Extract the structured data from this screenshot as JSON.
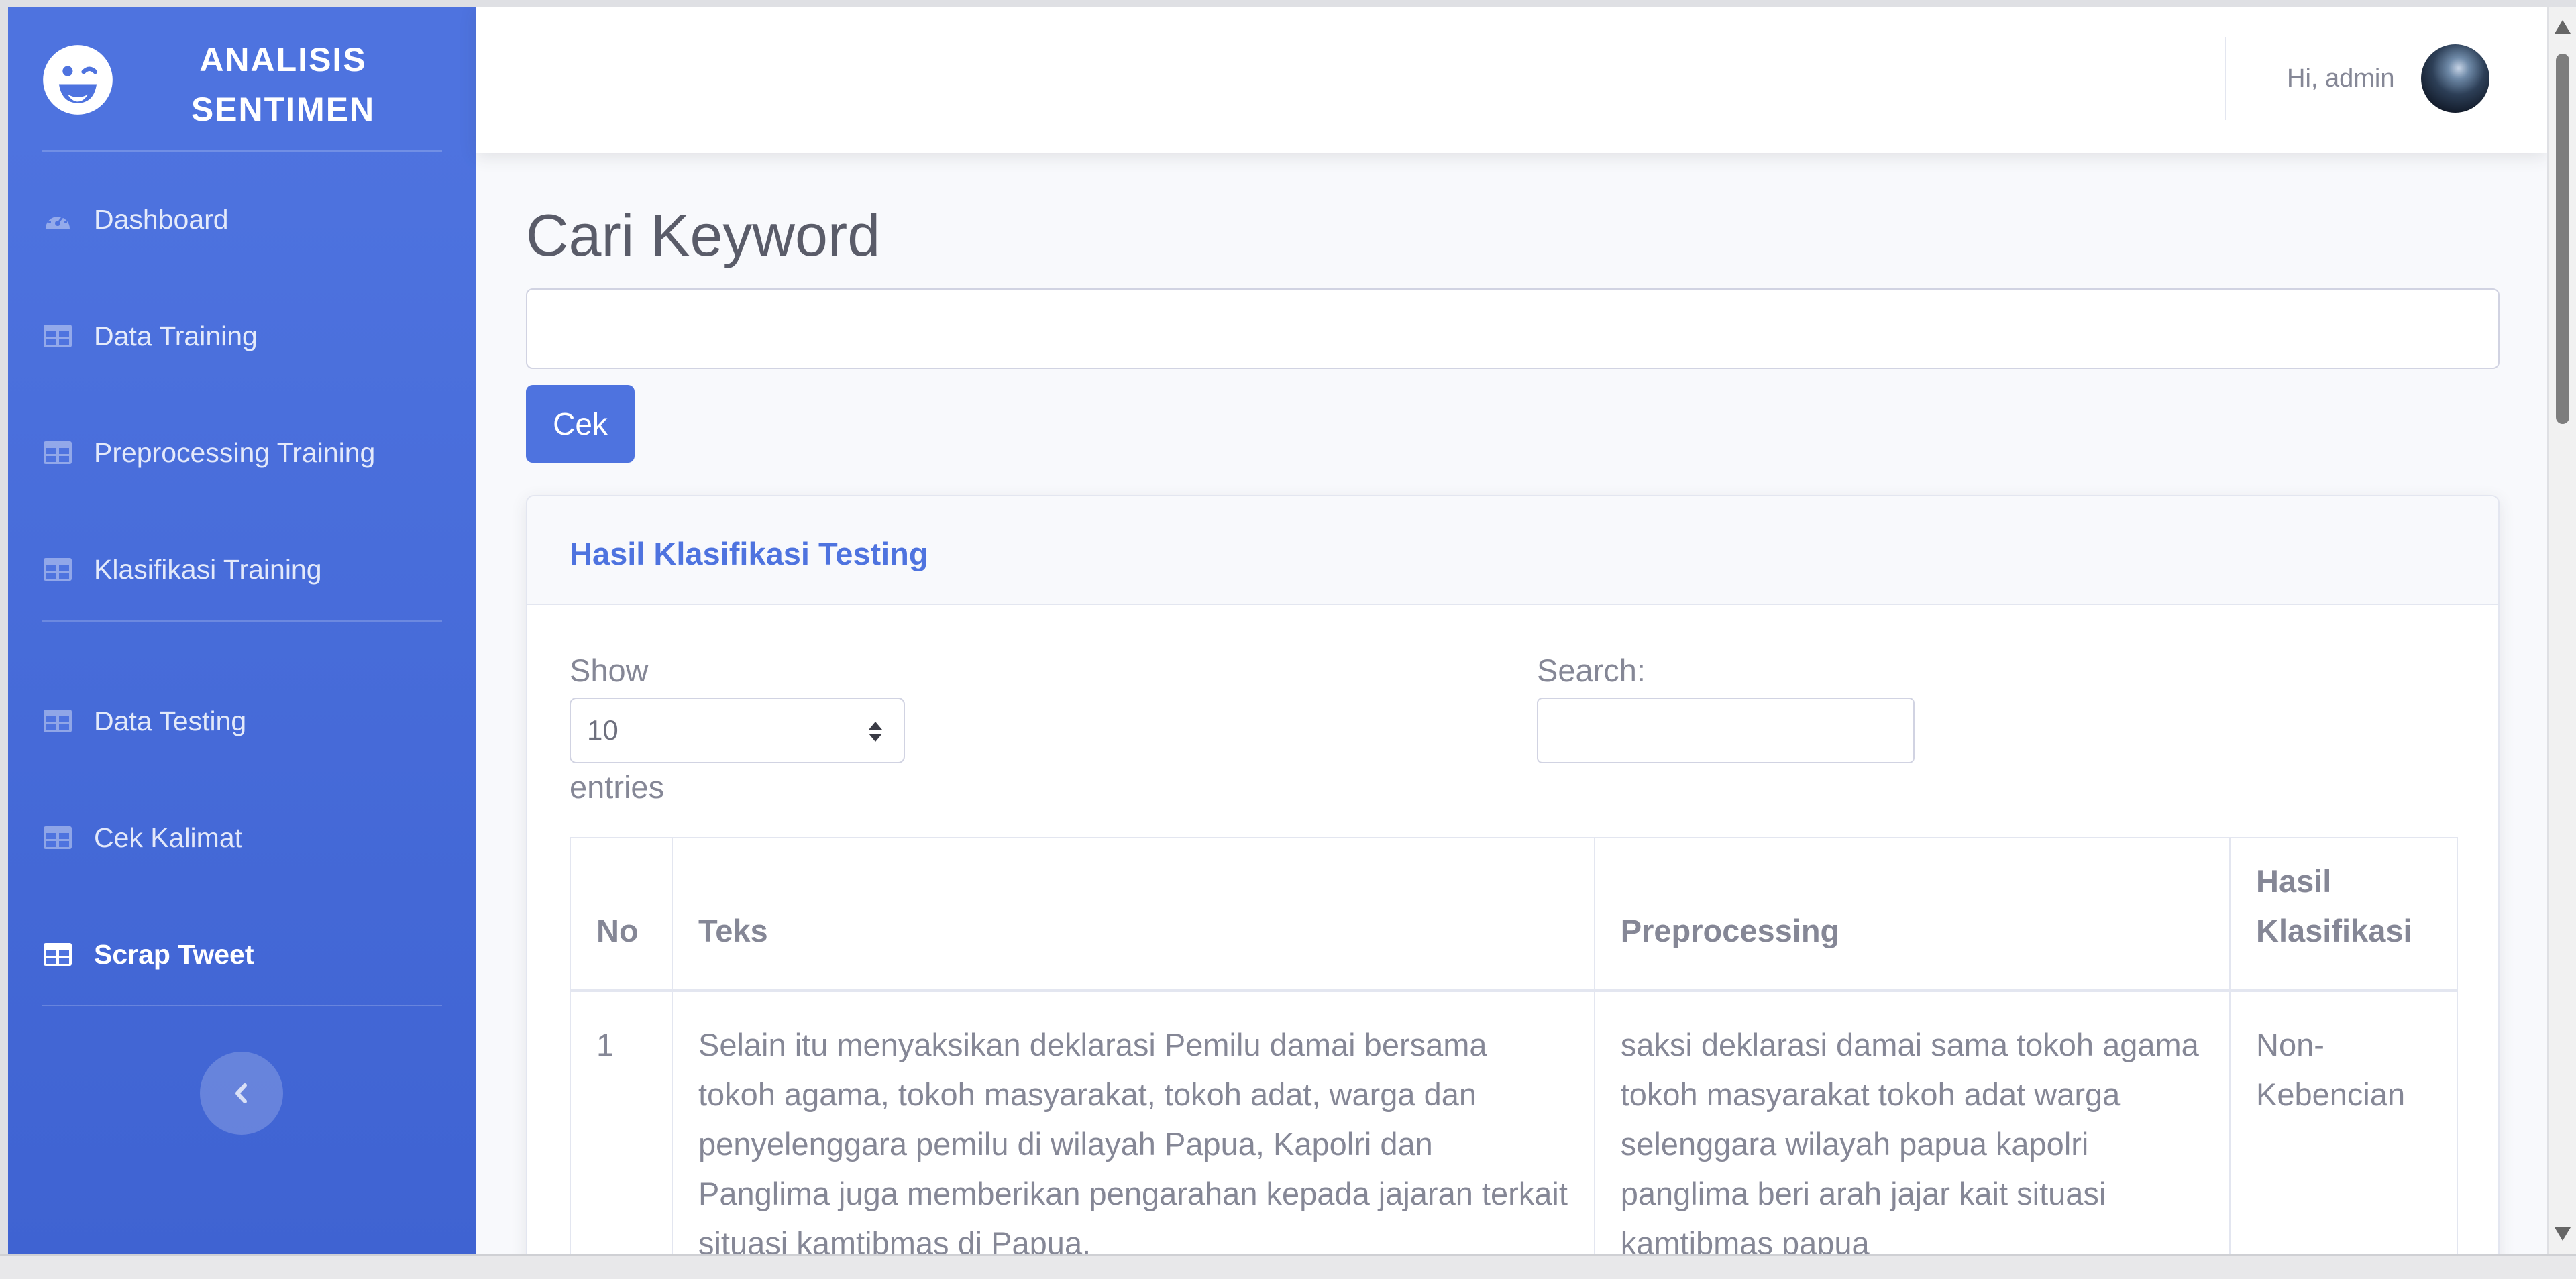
{
  "brand": {
    "title": "ANALISIS SENTIMEN",
    "icon": "laugh-wink-icon"
  },
  "sidebar": {
    "items": [
      {
        "label": "Dashboard",
        "icon": "tachometer-icon",
        "active": false
      },
      {
        "label": "Data Training",
        "icon": "table-icon",
        "active": false
      },
      {
        "label": "Preprocessing Training",
        "icon": "table-icon",
        "active": false
      },
      {
        "label": "Klasifikasi Training",
        "icon": "table-icon",
        "active": false
      },
      {
        "label": "Data Testing",
        "icon": "table-icon",
        "active": false
      },
      {
        "label": "Cek Kalimat",
        "icon": "table-icon",
        "active": false
      },
      {
        "label": "Scrap Tweet",
        "icon": "table-icon",
        "active": true
      }
    ],
    "toggle_icon": "chevron-left-icon"
  },
  "topbar": {
    "user_greeting": "Hi, admin"
  },
  "page": {
    "title": "Cari Keyword",
    "keyword_value": "",
    "submit_label": "Cek"
  },
  "card": {
    "title": "Hasil Klasifikasi Testing",
    "length": {
      "label_before": "Show",
      "selected": "10",
      "label_after": "entries"
    },
    "search": {
      "label": "Search:",
      "value": ""
    },
    "table": {
      "columns": [
        "No",
        "Teks",
        "Preprocessing",
        "Hasil Klasifikasi"
      ],
      "rows": [
        {
          "no": "1",
          "teks": "Selain itu menyaksikan deklarasi Pemilu damai bersama tokoh agama, tokoh masyarakat, tokoh adat, warga dan penyelenggara pemilu di wilayah Papua, Kapolri dan Panglima juga memberikan pengarahan kepada jajaran terkait situasi kamtibmas di Papua.",
          "preprocessing": "saksi deklarasi damai sama tokoh agama tokoh masyarakat tokoh adat warga selenggara wilayah papua kapolri panglima beri arah jajar kait situasi kamtibmas papua",
          "hasil": "Non-Kebencian"
        }
      ]
    }
  },
  "colors": {
    "primary": "#4e73df",
    "text_gray": "#858796",
    "heading": "#5a5c69"
  }
}
